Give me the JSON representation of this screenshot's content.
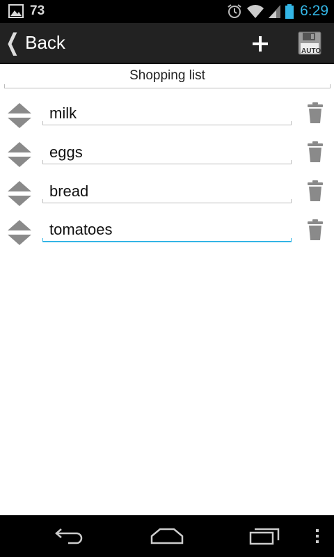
{
  "status_bar": {
    "notification_count": "73",
    "time": "6:29",
    "icons": [
      "image-notification-icon",
      "alarm-icon",
      "wifi-icon",
      "signal-icon",
      "battery-icon"
    ]
  },
  "action_bar": {
    "back_label": "Back",
    "add_icon": "plus-icon",
    "save_icon_text": "AUTO"
  },
  "list": {
    "title": "Shopping list",
    "items": [
      {
        "value": "milk"
      },
      {
        "value": "eggs"
      },
      {
        "value": "bread"
      },
      {
        "value": "tomatoes"
      }
    ],
    "active_index": 3
  },
  "nav_bar": {
    "icons": [
      "back-nav-icon",
      "home-nav-icon",
      "recents-nav-icon",
      "menu-overflow-icon"
    ]
  },
  "colors": {
    "accent": "#33b5e5",
    "action_bar": "#222222",
    "icon_gray": "#8a8a8a"
  }
}
